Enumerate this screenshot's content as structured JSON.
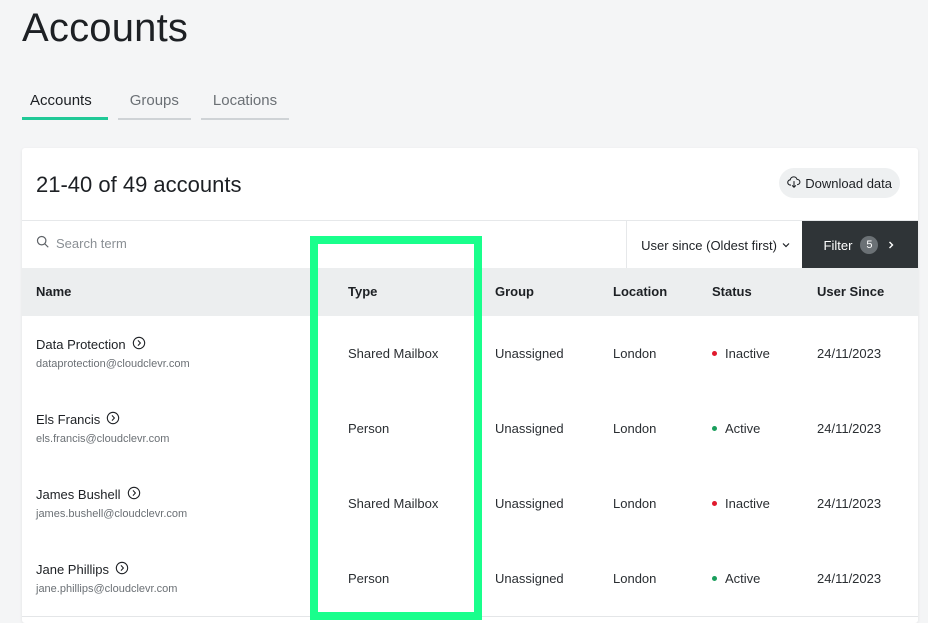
{
  "page": {
    "title": "Accounts"
  },
  "tabs": [
    {
      "label": "Accounts",
      "active": true
    },
    {
      "label": "Groups",
      "active": false
    },
    {
      "label": "Locations",
      "active": false
    }
  ],
  "card": {
    "count_title": "21-40 of 49 accounts",
    "download_label": "Download data",
    "search_placeholder": "Search term",
    "sort_label": "User since (Oldest first)",
    "filter_label": "Filter",
    "filter_count": "5"
  },
  "table": {
    "columns": [
      "Name",
      "Type",
      "Group",
      "Location",
      "Status",
      "User Since"
    ],
    "rows": [
      {
        "name": "Data Protection",
        "email": "dataprotection@cloudclevr.com",
        "type": "Shared Mailbox",
        "group": "Unassigned",
        "location": "London",
        "status": "Inactive",
        "user_since": "24/11/2023"
      },
      {
        "name": "Els Francis",
        "email": "els.francis@cloudclevr.com",
        "type": "Person",
        "group": "Unassigned",
        "location": "London",
        "status": "Active",
        "user_since": "24/11/2023"
      },
      {
        "name": "James Bushell",
        "email": "james.bushell@cloudclevr.com",
        "type": "Shared Mailbox",
        "group": "Unassigned",
        "location": "London",
        "status": "Inactive",
        "user_since": "24/11/2023"
      },
      {
        "name": "Jane Phillips",
        "email": "jane.phillips@cloudclevr.com",
        "type": "Person",
        "group": "Unassigned",
        "location": "London",
        "status": "Active",
        "user_since": "24/11/2023"
      }
    ]
  },
  "colors": {
    "accent": "#20c997",
    "active_dot": "#1a9e5c",
    "inactive_dot": "#e0192d",
    "highlight": "#19ff8c"
  },
  "icons": {
    "download": "cloud-download-icon",
    "search": "search-icon",
    "info": "info-chevron-icon",
    "sort": "chevron-down-icon",
    "filter_arrow": "chevron-right-icon"
  }
}
